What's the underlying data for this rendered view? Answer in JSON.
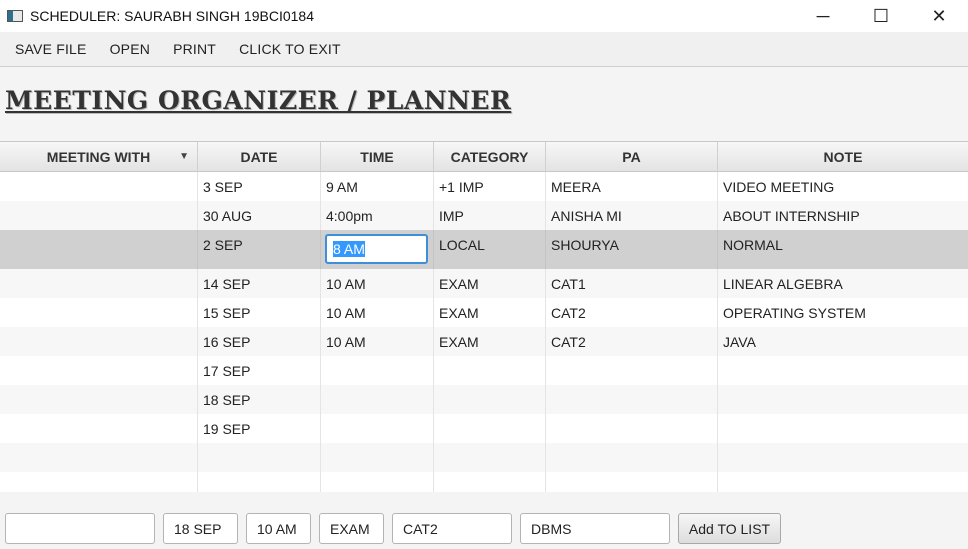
{
  "window": {
    "title": "SCHEDULER: SAURABH SINGH 19BCI0184",
    "minimize": "─",
    "maximize": "☐",
    "close": "✕"
  },
  "menu": [
    "SAVE FILE",
    "OPEN",
    "PRINT",
    "CLICK TO EXIT"
  ],
  "heading": "MEETING ORGANIZER / PLANNER",
  "table": {
    "columns": [
      "MEETING WITH",
      "DATE",
      "TIME",
      "CATEGORY",
      "PA",
      "NOTE"
    ],
    "sort_icon": "▼",
    "rows": [
      [
        "",
        "3 SEP",
        "9 AM",
        "+1 IMP",
        "MEERA",
        "VIDEO MEETING"
      ],
      [
        "",
        "30 AUG",
        "4:00pm",
        "IMP",
        "ANISHA MI",
        "ABOUT INTERNSHIP"
      ],
      [
        "",
        "2 SEP",
        "8 AM",
        "LOCAL",
        "SHOURYA",
        "NORMAL"
      ],
      [
        "",
        "14 SEP",
        "10 AM",
        "EXAM",
        "CAT1",
        "LINEAR ALGEBRA"
      ],
      [
        "",
        "15 SEP",
        "10 AM",
        "EXAM",
        "CAT2",
        "OPERATING SYSTEM"
      ],
      [
        "",
        "16 SEP",
        "10 AM",
        "EXAM",
        "CAT2",
        "JAVA"
      ],
      [
        "",
        "17 SEP",
        "",
        "",
        "",
        ""
      ],
      [
        "",
        "18 SEP",
        "",
        "",
        "",
        ""
      ],
      [
        "",
        "19 SEP",
        "",
        "",
        "",
        ""
      ],
      [
        "",
        "",
        "",
        "",
        "",
        ""
      ],
      [
        "",
        "",
        "",
        "",
        "",
        ""
      ]
    ],
    "selected_row": 2,
    "editing": {
      "row": 2,
      "col": 2,
      "value": "8 AM"
    }
  },
  "form": {
    "meeting_with": "",
    "date": "18 SEP",
    "time": "10 AM",
    "category": "EXAM",
    "pa": "CAT2",
    "note": "DBMS",
    "add_label": "Add TO LIST"
  }
}
